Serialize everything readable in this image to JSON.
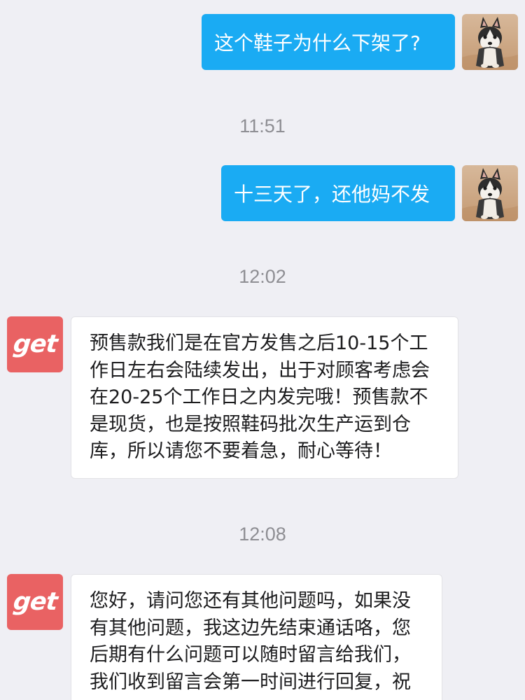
{
  "messages": [
    {
      "from": "user",
      "text": "这个鞋子为什么下架了?"
    },
    {
      "from": "user",
      "text": "十三天了，还他妈不发"
    },
    {
      "from": "shop",
      "lines": [
        "预售款我们是在官方发售之后10-15个工",
        "作日左右会陆续发出，出于对顾客考虑会",
        "在20-25个工作日之内发完哦！预售款不",
        "是现货，也是按照鞋码批次生产运到仓",
        "库，所以请您不要着急，耐心等待！"
      ]
    },
    {
      "from": "shop",
      "lines": [
        "您好，请问您还有其他问题吗，如果没",
        "有其他问题，我这边先结束通话咯，您",
        "后期有什么问题可以随时留言给我们，",
        "我们收到留言会第一时间进行回复，祝"
      ]
    }
  ],
  "timestamps": [
    "11:51",
    "12:02",
    "12:08"
  ],
  "shop_avatar": {
    "text": "get",
    "color": "#e96263"
  },
  "user_avatar": {
    "icon": "husky-puppy-photo"
  },
  "colors": {
    "background": "#efeff4",
    "outgoing_bubble": "#1aabf3",
    "incoming_bubble": "#ffffff",
    "timestamp_text": "#8e8e93"
  }
}
